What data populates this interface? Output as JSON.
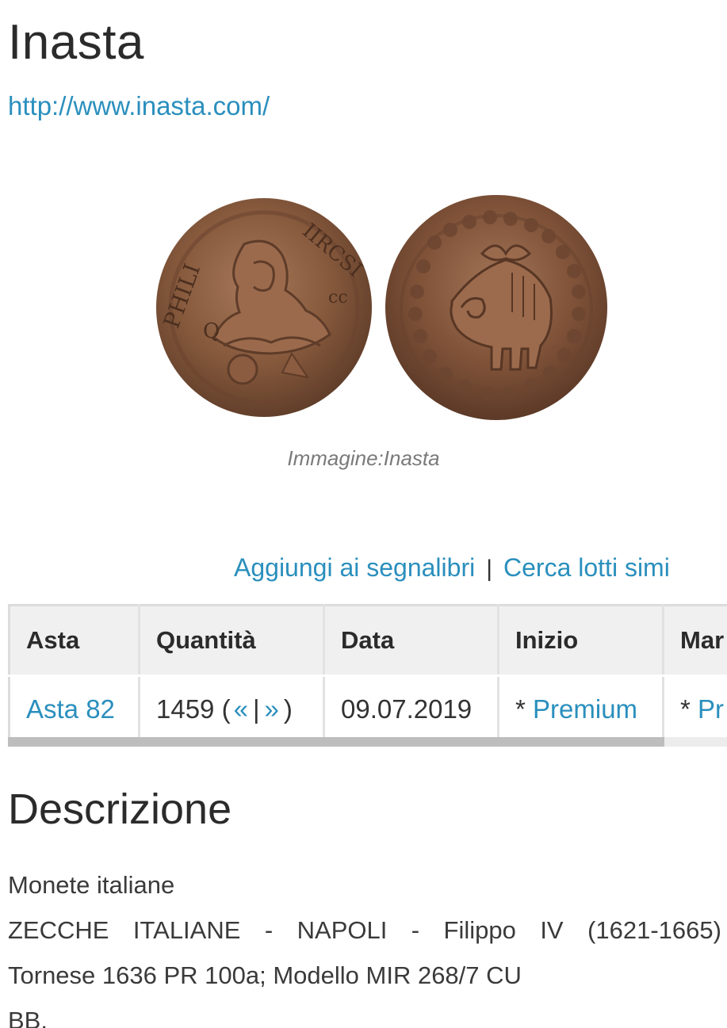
{
  "page": {
    "title": "Inasta",
    "site_url": "http://www.inasta.com/"
  },
  "figure": {
    "caption": "Immagine:Inasta",
    "obverse_icon": "coin-obverse-portrait",
    "reverse_icon": "coin-reverse-golden-fleece"
  },
  "actions": {
    "bookmark_label": "Aggiungi ai segnalibri",
    "separator": "|",
    "similar_label": "Cerca lotti simi"
  },
  "lot_table": {
    "headers": [
      "Asta",
      "Quantità",
      "Data",
      "Inizio",
      "Mar"
    ],
    "row": {
      "asta": "Asta 82",
      "quantity_number": "1459",
      "quantity_open": "(",
      "quantity_prev": "«",
      "quantity_sep": "|",
      "quantity_next": "»",
      "quantity_close": ")",
      "date": "09.07.2019",
      "inizio_prefix": "*",
      "inizio_link": "Premium",
      "mar_prefix": "*",
      "mar_link": "Pr"
    }
  },
  "description": {
    "heading": "Descrizione",
    "category": "Monete italiane",
    "line1_words": [
      "ZECCHE",
      "ITALIANE",
      "-",
      "NAPOLI",
      "-",
      "Filippo",
      "IV",
      "(1621-1665)"
    ],
    "line2": "Tornese 1636 PR 100a; Modello MIR 268/7 CU",
    "line3": "BB."
  },
  "colors": {
    "link": "#2a8fbd",
    "header_bg": "#f0f0f0",
    "coin_bronze": "#8a5a38"
  }
}
